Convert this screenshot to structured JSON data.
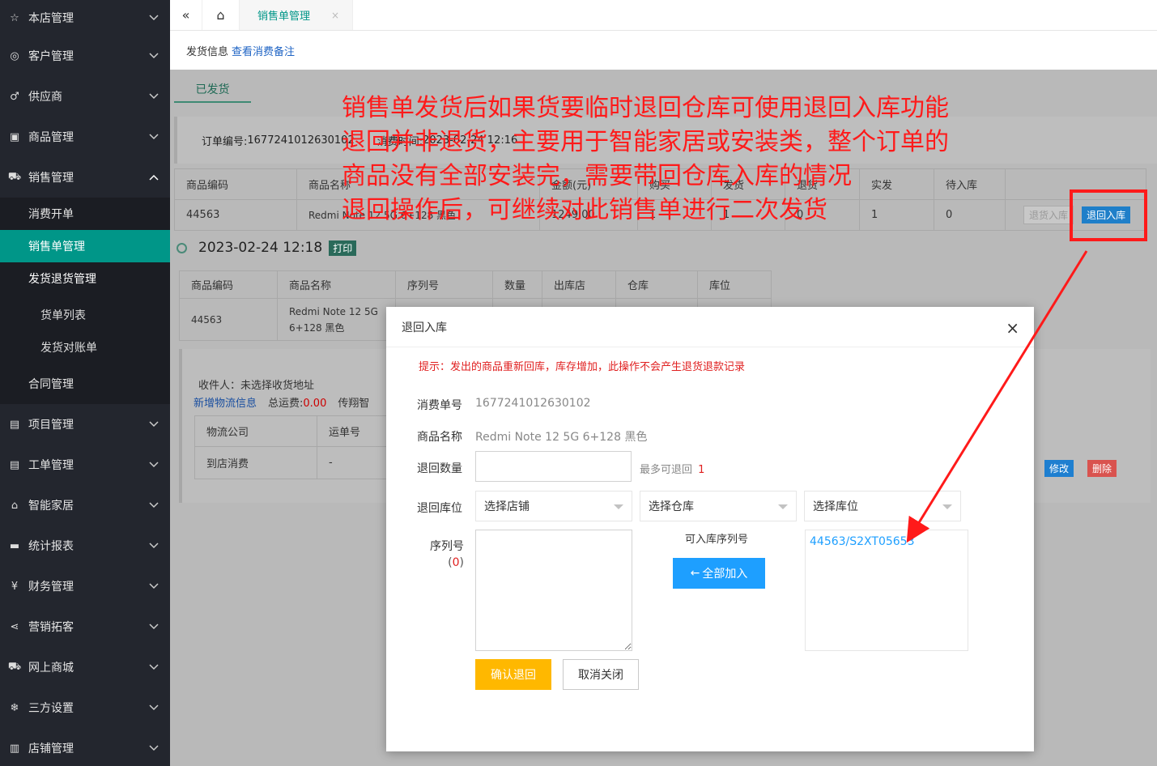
{
  "sidebar": {
    "items": [
      {
        "label": "本店管理",
        "icon": "star-icon"
      },
      {
        "label": "客户管理",
        "icon": "user-icon"
      },
      {
        "label": "供应商",
        "icon": "male-icon"
      },
      {
        "label": "商品管理",
        "icon": "gift-icon"
      },
      {
        "label": "销售管理",
        "icon": "cart-icon"
      }
    ],
    "sales_sub": [
      "消费开单",
      "销售单管理",
      "发货退货管理"
    ],
    "ship_sub": [
      "货单列表",
      "发货对账单"
    ],
    "contract": "合同管理",
    "items_after": [
      {
        "label": "项目管理",
        "icon": "doc-icon"
      },
      {
        "label": "工单管理",
        "icon": "doc-icon"
      },
      {
        "label": "智能家居",
        "icon": "home-icon"
      },
      {
        "label": "统计报表",
        "icon": "report-icon"
      },
      {
        "label": "财务管理",
        "icon": "yen-icon"
      },
      {
        "label": "营销拓客",
        "icon": "share-icon"
      },
      {
        "label": "网上商城",
        "icon": "cart-icon"
      },
      {
        "label": "三方设置",
        "icon": "snowflake-icon"
      },
      {
        "label": "店铺管理",
        "icon": "shop-icon"
      }
    ]
  },
  "topbar": {
    "tab": "销售单管理",
    "close": "×"
  },
  "infobar": {
    "label": "发货信息",
    "link": "查看消费备注"
  },
  "content": {
    "tab_shipped": "已发货",
    "order_no_label": "订单编号:",
    "order_no": "1677241012630102",
    "time_label": "消费时间:",
    "time": "2023-02-24 12:16",
    "grid1": {
      "headers": [
        "商品编码",
        "商品名称",
        "金额(元)",
        "购买",
        "发货",
        "退货",
        "实发",
        "待入库",
        ""
      ],
      "row": [
        "44563",
        "Redmi Note 12 5G 6+128 黑色",
        "1249.00",
        "1",
        "1",
        "0",
        "1",
        "0"
      ],
      "btn_disabled": "退货入库",
      "btn_return": "退回入库"
    },
    "date": "2023-02-24 12:18",
    "print": "打印",
    "grid2": {
      "headers": [
        "商品编码",
        "商品名称",
        "序列号",
        "数量",
        "出库店",
        "仓库",
        "库位"
      ],
      "code": "44563",
      "name1": "Redmi Note 12 5G",
      "name2": "6+128 黑色"
    },
    "ship": {
      "receiver": "收件人：未选择收货地址",
      "add_logistics": "新增物流信息",
      "freight_label": "总运费:",
      "freight": "0.00",
      "chuanxiang": "传翔智",
      "logistics_headers": [
        "物流公司",
        "运单号"
      ],
      "logistics_row": [
        "到店消费",
        "-"
      ],
      "edit": "修改",
      "delete": "删除"
    }
  },
  "annotation": "销售单发货后如果货要临时退回仓库可使用退回入库功能退回并非退货，主要用于智能家居或安装类，整个订单的商品没有全部安装完，需要带回仓库入库的情况退回操作后，可继续对此销售单进行二次发货",
  "annotation_lines": [
    "销售单发货后如果货要临时退回仓库可使用退回入库功能",
    "退回并非退货，主要用于智能家居或安装类，整个订单的",
    "商品没有全部安装完，需要带回仓库入库的情况",
    "退回操作后，可继续对此销售单进行二次发货"
  ],
  "modal": {
    "title": "退回入库",
    "close": "×",
    "tip": "提示：发出的商品重新回库，库存增加，此操作不会产生退货退款记录",
    "order_label": "消费单号",
    "order_value": "1677241012630102",
    "product_label": "商品名称",
    "product_value": "Redmi Note 12 5G 6+128 黑色",
    "qty_label": "退回数量",
    "qty_value": "",
    "max_label": "最多可退回",
    "max_value": "1",
    "loc_label": "退回库位",
    "store_select": "选择店铺",
    "warehouse_select": "选择仓库",
    "bin_select": "选择库位",
    "serial_label": "序列号",
    "serial_count_open": "(",
    "serial_count": "0",
    "serial_count_close": ")",
    "available_label": "可入库序列号",
    "add_all": "全部加入",
    "serial_item": "44563/S2XT05653",
    "confirm": "确认退回",
    "cancel": "取消关闭"
  },
  "colors": {
    "sidebar": "#23262e",
    "active": "#009688",
    "blue": "#1e9fff",
    "yellow": "#ffb800",
    "annot": "#ff1a1a"
  }
}
